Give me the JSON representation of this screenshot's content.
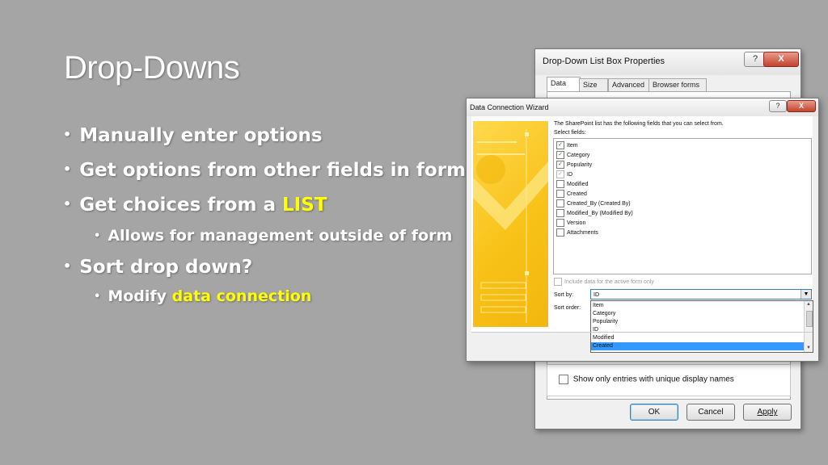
{
  "slide": {
    "title": "Drop-Downs",
    "bullets": [
      {
        "text": "Manually enter options"
      },
      {
        "text": "Get options from other fields in form"
      },
      {
        "text": "Get choices from a ",
        "highlight": "LIST"
      },
      {
        "text": "Allows for management outside of form",
        "sub": true
      },
      {
        "text": "Sort drop down?"
      },
      {
        "text": "Modify ",
        "highlight": "data connection",
        "sub": true
      }
    ],
    "highlight_color": "#ffff00"
  },
  "back_dialog": {
    "title": "Drop-Down List Box Properties",
    "help_label": "?",
    "close_label": "X",
    "tabs": [
      {
        "label": "Data",
        "active": true
      },
      {
        "label": "Size"
      },
      {
        "label": "Advanced"
      },
      {
        "label": "Browser forms"
      }
    ],
    "show_only_label": "Show only entries with unique display names",
    "buttons": {
      "ok": "OK",
      "cancel": "Cancel",
      "apply": "Apply"
    }
  },
  "wizard": {
    "title": "Data Connection Wizard",
    "help_label": "?",
    "close_label": "X",
    "intro": "The SharePoint list has the following fields that you can select from.",
    "select_label": "Select fields:",
    "fields": [
      {
        "label": "Item",
        "checked": true
      },
      {
        "label": "Category",
        "checked": true
      },
      {
        "label": "Popularity",
        "checked": true
      },
      {
        "label": "ID",
        "checked": true,
        "disabled": true
      },
      {
        "label": "Modified",
        "checked": false
      },
      {
        "label": "Created",
        "checked": false
      },
      {
        "label": "Created_By (Created By)",
        "checked": false
      },
      {
        "label": "Modified_By (Modified By)",
        "checked": false
      },
      {
        "label": "Version",
        "checked": false
      },
      {
        "label": "Attachments",
        "checked": false
      }
    ],
    "include_label": "Include data for the active form only",
    "sort_by_label": "Sort by:",
    "sort_by_value": "ID",
    "sort_order_label": "Sort order:",
    "sort_options": [
      "Item",
      "Category",
      "Popularity",
      "ID",
      "Modified",
      "Created"
    ],
    "sort_selected": "Created"
  }
}
